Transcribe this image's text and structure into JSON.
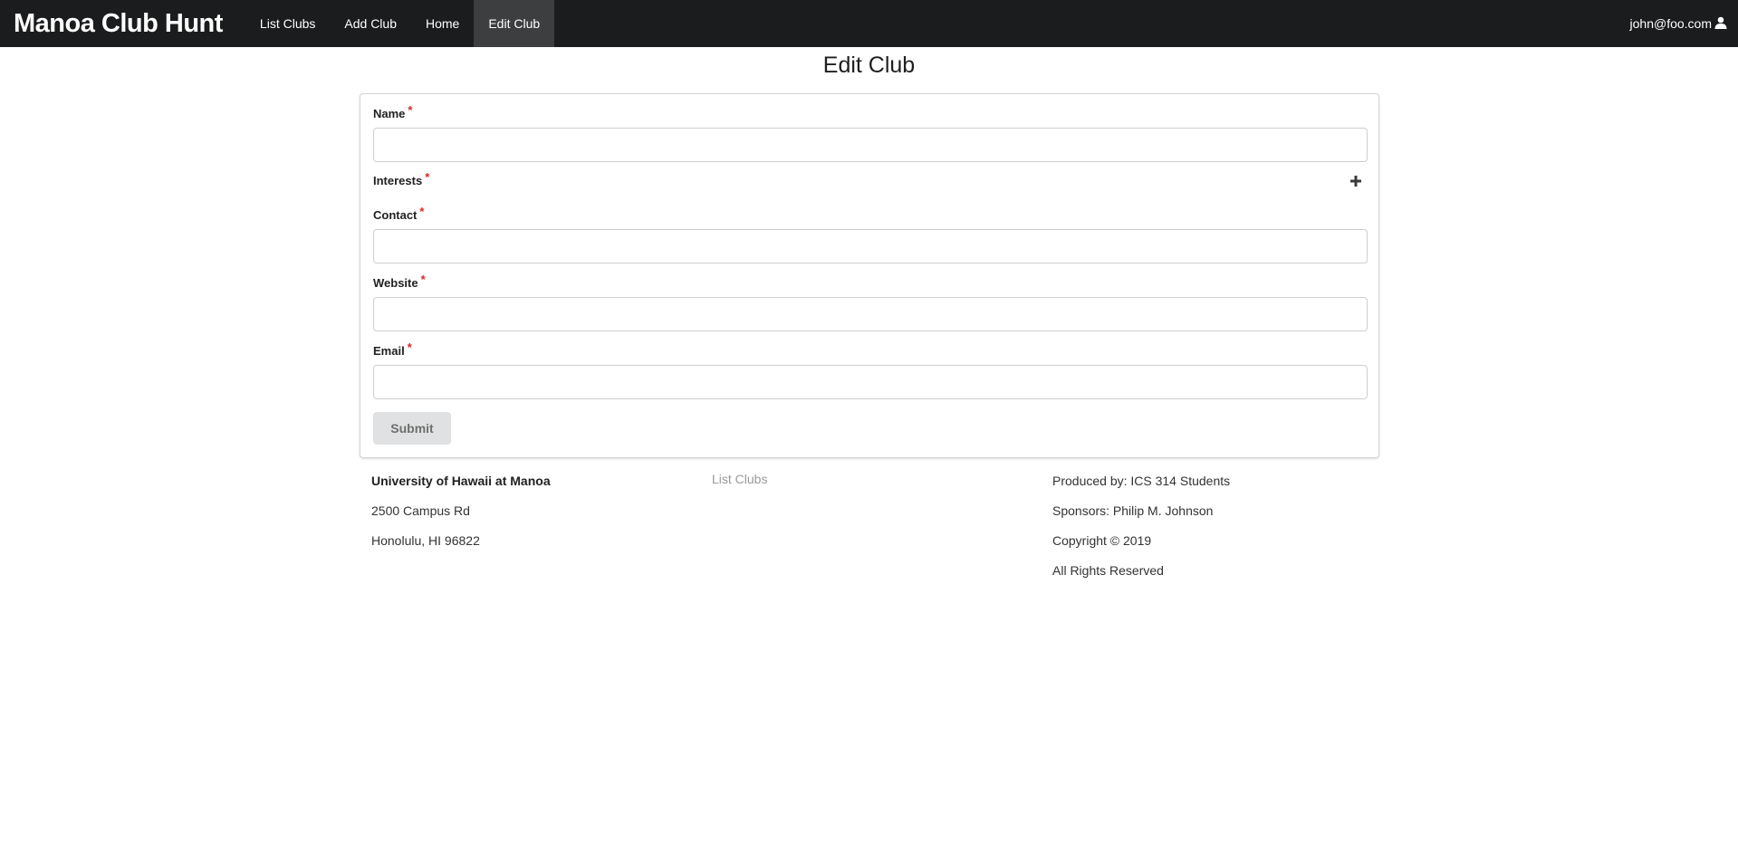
{
  "nav": {
    "brand": "Manoa Club Hunt",
    "items": [
      {
        "label": "List Clubs",
        "active": false
      },
      {
        "label": "Add Club",
        "active": false
      },
      {
        "label": "Home",
        "active": false
      },
      {
        "label": "Edit Club",
        "active": true
      }
    ],
    "user": "john@foo.com",
    "user_icon": "user-icon"
  },
  "page": {
    "title": "Edit Club"
  },
  "form": {
    "required_marker": "*",
    "fields": {
      "name": {
        "label": "Name",
        "value": ""
      },
      "interests": {
        "label": "Interests",
        "add_icon": "plus-icon"
      },
      "contact": {
        "label": "Contact",
        "value": ""
      },
      "website": {
        "label": "Website",
        "value": ""
      },
      "email": {
        "label": "Email",
        "value": ""
      }
    },
    "submit_label": "Submit"
  },
  "footer": {
    "address": {
      "name": "University of Hawaii at Manoa",
      "street": "2500 Campus Rd",
      "city": "Honolulu, HI 96822"
    },
    "link": "List Clubs",
    "credits": {
      "produced_by": "Produced by: ICS 314 Students",
      "sponsors": "Sponsors: Philip M. Johnson",
      "copyright": "Copyright © 2019",
      "rights": "All Rights Reserved"
    }
  },
  "colors": {
    "navbar": "#1b1c1d",
    "navbar_active": "#3d3e3f",
    "required": "#db2828",
    "button": "#e0e1e2"
  }
}
